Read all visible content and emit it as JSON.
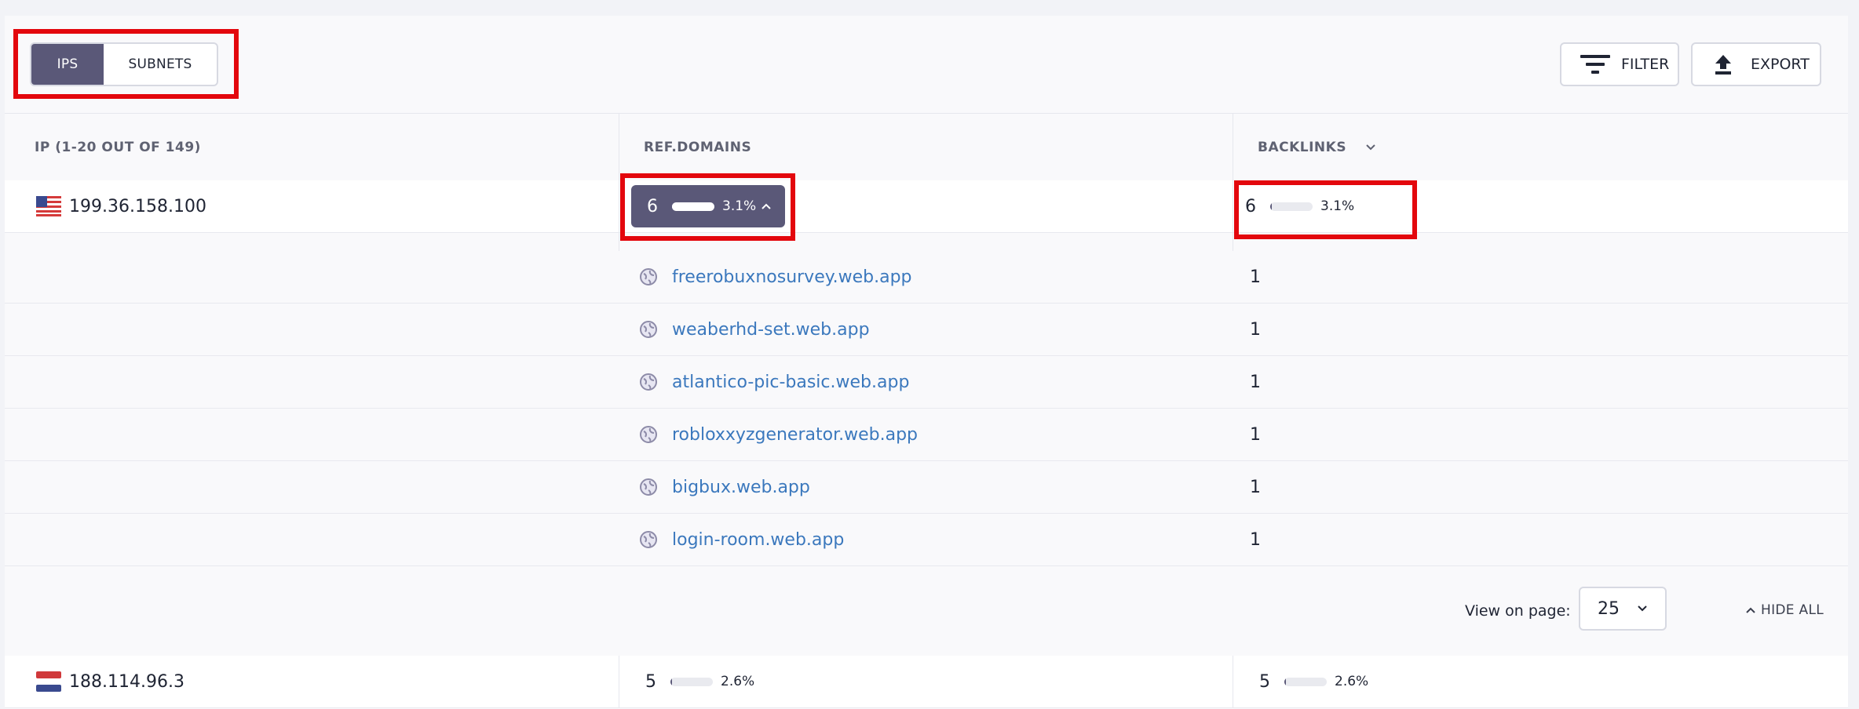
{
  "toggle": {
    "ips_label": "IPS",
    "subnets_label": "SUBNETS",
    "active": "IPS"
  },
  "toolbar": {
    "filter_label": "FILTER",
    "export_label": "EXPORT"
  },
  "table": {
    "columns": {
      "ip": "IP (1-20 OUT OF 149)",
      "ref_domains": "REF.DOMAINS",
      "backlinks": "BACKLINKS"
    },
    "rows": [
      {
        "flag": "us-flag",
        "ip": "199.36.158.100",
        "ref_domains": {
          "value": "6",
          "percent": "3.1%",
          "fraction": 0.031,
          "expanded": true
        },
        "backlinks": {
          "value": "6",
          "percent": "3.1%",
          "fraction": 0.031
        },
        "domains": [
          {
            "name": "freerobuxnosurvey.web.app",
            "backlinks": "1"
          },
          {
            "name": "weaberhd-set.web.app",
            "backlinks": "1"
          },
          {
            "name": "atlantico-pic-basic.web.app",
            "backlinks": "1"
          },
          {
            "name": "robloxxyzgenerator.web.app",
            "backlinks": "1"
          },
          {
            "name": "bigbux.web.app",
            "backlinks": "1"
          },
          {
            "name": "login-room.web.app",
            "backlinks": "1"
          }
        ]
      },
      {
        "flag": "nl-flag",
        "ip": "188.114.96.3",
        "ref_domains": {
          "value": "5",
          "percent": "2.6%",
          "fraction": 0.026,
          "expanded": false
        },
        "backlinks": {
          "value": "5",
          "percent": "2.6%",
          "fraction": 0.026
        }
      }
    ]
  },
  "pager": {
    "label": "View on page:",
    "value": "25",
    "hide_all": "HIDE ALL"
  },
  "colors": {
    "accent": "#5a5878",
    "link": "#3b78bd",
    "highlight": "#e3070d"
  }
}
